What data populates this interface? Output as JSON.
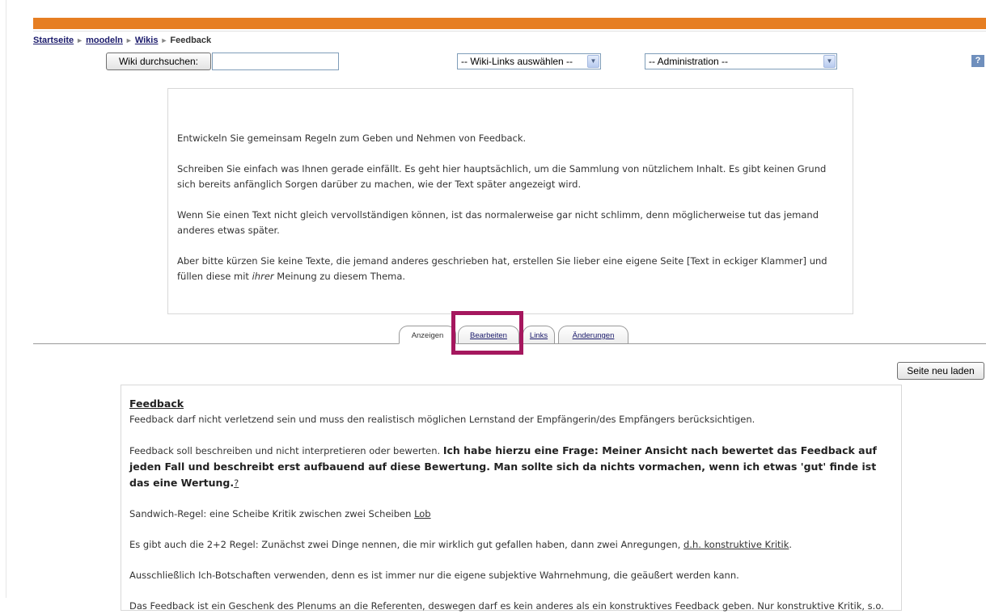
{
  "breadcrumb": {
    "items": [
      "Startseite",
      "moodeln",
      "Wikis"
    ],
    "current": "Feedback",
    "separator": "►"
  },
  "toolbar": {
    "search_button": "Wiki durchsuchen:",
    "search_value": "",
    "links_select": "-- Wiki-Links auswählen --",
    "admin_select": "-- Administration --",
    "help": "?"
  },
  "description": {
    "p1": "Entwickeln Sie gemeinsam Regeln zum Geben und Nehmen von Feedback.",
    "p2": "Schreiben Sie einfach was Ihnen gerade einfällt. Es geht hier hauptsächlich, um die Sammlung von nützlichem Inhalt. Es gibt keinen Grund sich bereits anfänglich Sorgen darüber zu machen, wie der Text später angezeigt wird.",
    "p3": "Wenn Sie einen Text nicht gleich vervollständigen können, ist das normalerweise gar nicht schlimm, denn möglicherweise tut das jemand anderes etwas später.",
    "p4_a": "Aber bitte kürzen Sie keine Texte, die jemand anderes geschrieben hat, erstellen Sie lieber eine eigene Seite [Text in eckiger Klammer] und füllen diese mit ",
    "p4_em": "ihrer",
    "p4_b": " Meinung zu diesem Thema."
  },
  "tabs": {
    "view": "Anzeigen",
    "edit": "Bearbeiten",
    "links": "Links",
    "changes": "Änderungen"
  },
  "reload_button": "Seite neu laden",
  "content": {
    "title": "Feedback",
    "line1": "Feedback darf nicht verletzend sein und muss den realistisch möglichen Lernstand der Empfängerin/des Empfängers berücksichtigen.",
    "line2_a": "Feedback soll beschreiben und nicht interpretieren oder bewerten. ",
    "line2_bold": "Ich habe hierzu eine Frage: Meiner Ansicht nach bewertet das Feedback auf jeden Fall und beschreibt erst aufbauend auf diese Bewertung. Man sollte sich da nichts vormachen, wenn ich etwas 'gut' finde ist das eine Wertung.",
    "line2_link": "?",
    "line3_a": "Sandwich-Regel: eine Scheibe Kritik zwischen zwei Scheiben ",
    "line3_link": "Lob",
    "line4_a": "Es gibt auch die 2+2 Regel: Zunächst zwei Dinge nennen, die mir wirklich gut gefallen haben, dann zwei Anregungen, ",
    "line4_link": "d.h. konstruktive Kritik",
    "line4_end": ".",
    "line5": "Ausschließlich Ich-Botschaften verwenden, denn es ist immer nur die eigene subjektive Wahrnehmung, die geäußert werden kann.",
    "line6": "Das Feedback ist ein Geschenk des Plenums an die Referenten, deswegen darf es kein anderes als ein konstruktives Feedback geben. Nur konstruktive Kritik, s.o."
  },
  "colors": {
    "header_bar": "#e67e22",
    "highlight_frame": "#a5175e"
  }
}
